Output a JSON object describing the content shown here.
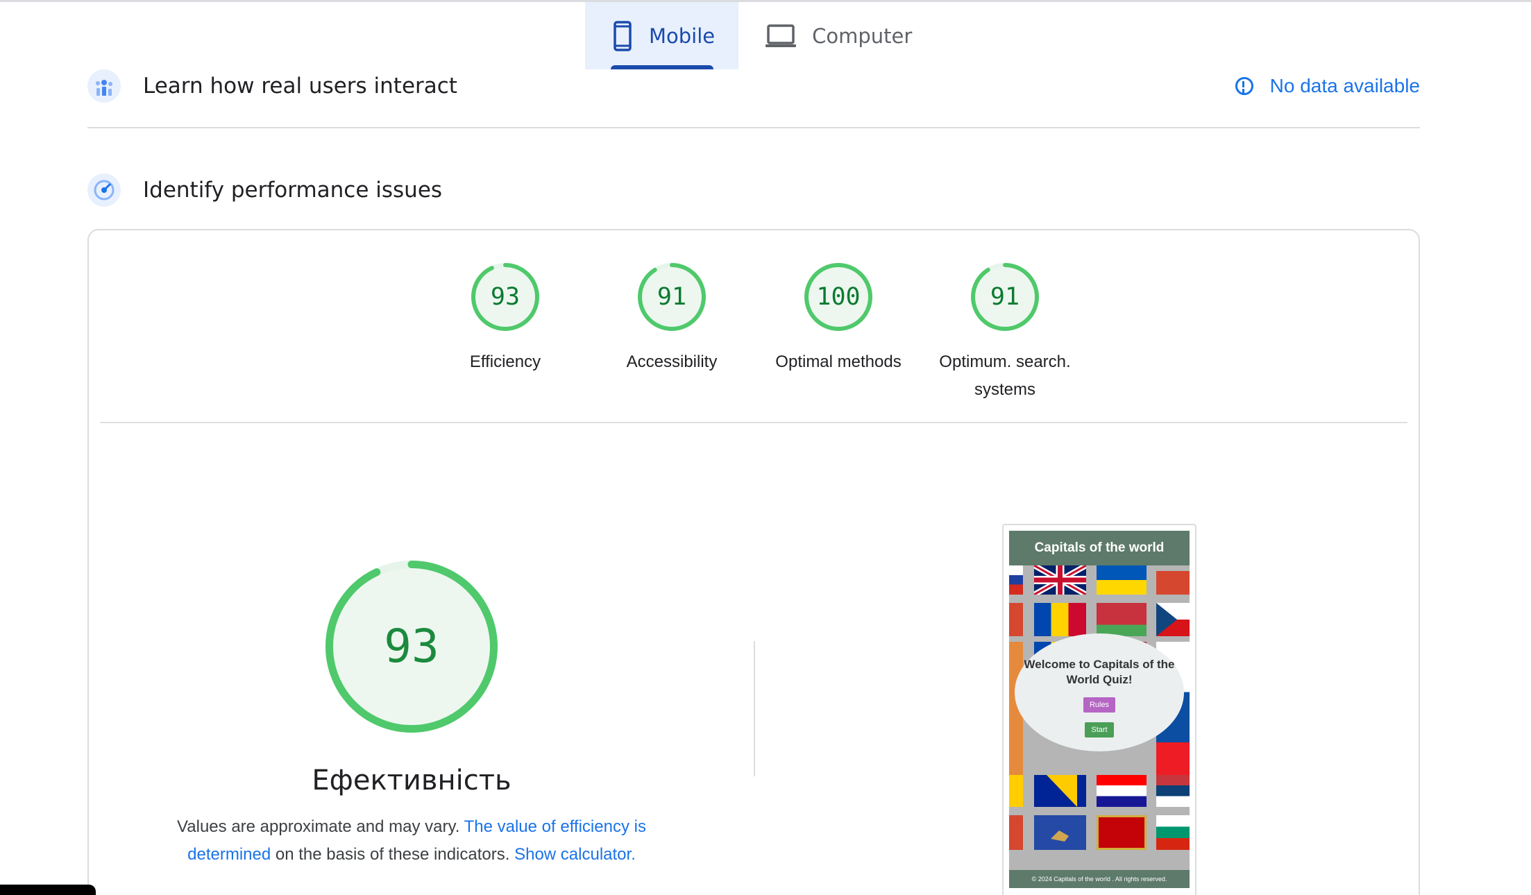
{
  "tabs": [
    {
      "label": "Mobile",
      "icon": "smartphone-icon",
      "active": true
    },
    {
      "label": "Computer",
      "icon": "laptop-icon",
      "active": false
    }
  ],
  "field_data": {
    "title": "Learn how real users interact",
    "status": "No data available"
  },
  "lab_data": {
    "title": "Identify performance issues"
  },
  "categories": [
    {
      "score": "93",
      "value": 93,
      "label": "Efficiency"
    },
    {
      "score": "91",
      "value": 91,
      "label": "Accessibility"
    },
    {
      "score": "100",
      "value": 100,
      "label": "Optimal methods"
    },
    {
      "score": "91",
      "value": 91,
      "label": "Optimum. search. systems"
    }
  ],
  "main_score": {
    "score": "93",
    "value": 93,
    "title": "Ефективність",
    "desc_prefix": "Values are approximate and may vary.",
    "link_value": "The value of efficiency is determined",
    "desc_middle": "on the basis of these indicators.",
    "link_calculator": "Show calculator."
  },
  "screenshot": {
    "header": "Capitals of the world",
    "welcome": "Welcome to Capitals of the World Quiz!",
    "rules_button": "Rules",
    "start_button": "Start",
    "footer": "© 2024 Capitals of the world . All rights reserved."
  },
  "colors": {
    "accent": "#1a73e8",
    "tab_active": "#1a4aab",
    "score_good": "#0cce6b",
    "score_text": "#0b7a31"
  }
}
